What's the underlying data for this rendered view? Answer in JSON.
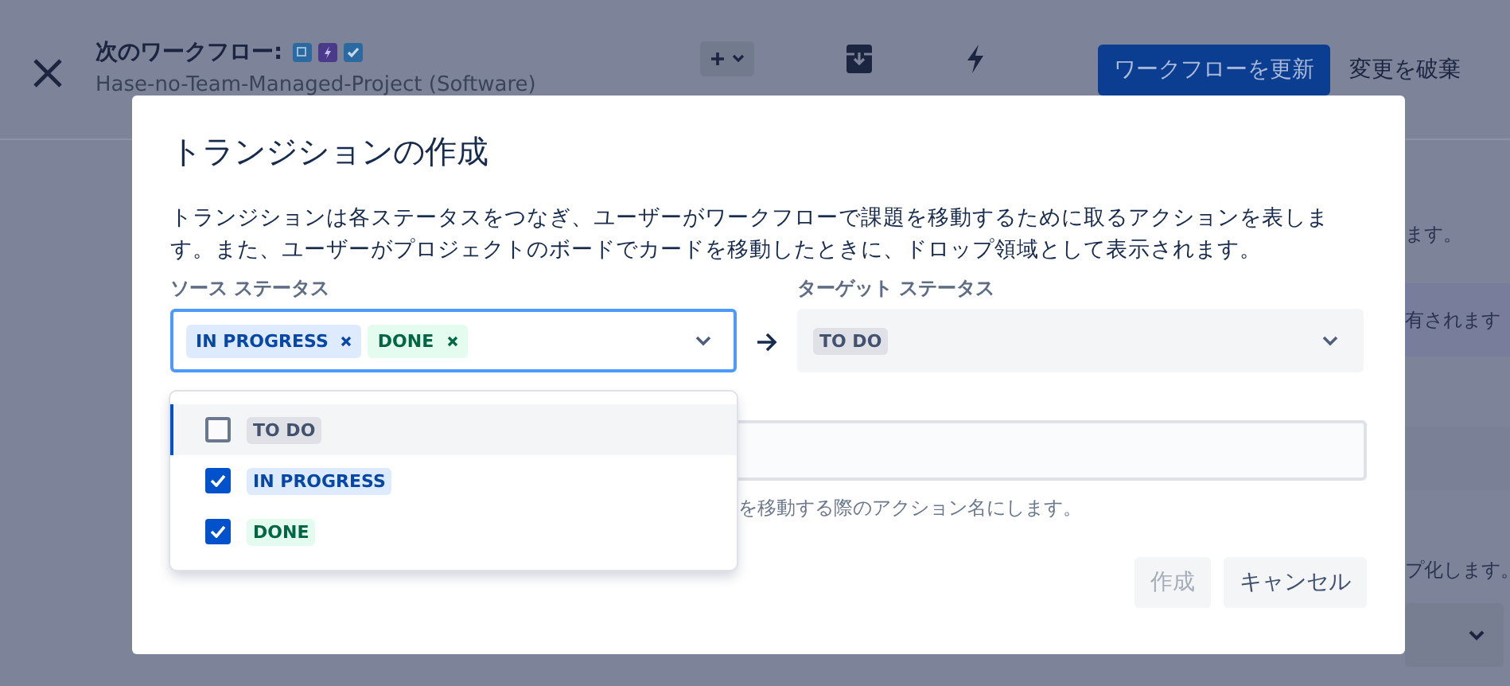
{
  "header": {
    "title": "次のワークフロー:",
    "subtitle": "Hase-no-Team-Managed-Project (Software)",
    "update_button": "ワークフローを更新",
    "discard_button": "変更を破棄"
  },
  "background_texts": [
    "ます。",
    "有されます",
    "プ化します。"
  ],
  "dialog": {
    "title": "トランジションの作成",
    "description": "トランジションは各ステータスをつなぎ、ユーザーがワークフローで課題を移動するために取るアクションを表します。また、ユーザーがプロジェクトのボードでカードを移動したときに、ドロップ領域として表示されます。",
    "source": {
      "label": "ソース ステータス",
      "focused": true,
      "tags": [
        {
          "text": "IN PROGRESS",
          "kind": "inprogress"
        },
        {
          "text": "DONE",
          "kind": "done"
        }
      ]
    },
    "target": {
      "label": "ターゲット ステータス",
      "value": {
        "text": "TO DO",
        "kind": "todo"
      }
    },
    "options": [
      {
        "text": "TO DO",
        "kind": "todo",
        "checked": false,
        "focused": true
      },
      {
        "text": "IN PROGRESS",
        "kind": "inprogress",
        "checked": true,
        "focused": false
      },
      {
        "text": "DONE",
        "kind": "done",
        "checked": true,
        "focused": false
      }
    ],
    "name_help": "を移動する際のアクション名にします。",
    "buttons": [
      {
        "label": "作成",
        "kind": "primary",
        "disabled": true
      },
      {
        "label": "キャンセル",
        "kind": "subtle",
        "disabled": false
      }
    ]
  }
}
